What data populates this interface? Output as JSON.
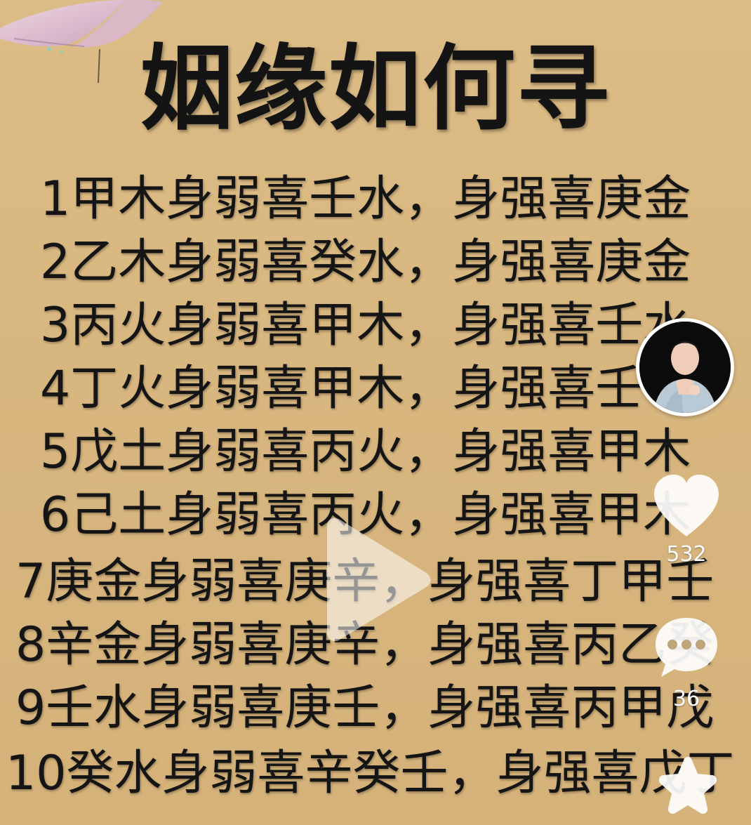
{
  "title": "姻缘如何寻",
  "lines": [
    "1甲木身弱喜壬水，身强喜庚金",
    "2乙木身弱喜癸水，身强喜庚金",
    "3丙火身弱喜甲木，身强喜壬水",
    "4丁火身弱喜甲木，身强喜壬",
    "5戊土身弱喜丙火，身强喜甲木",
    "6己土身弱喜丙火，身强喜甲木",
    "7庚金身弱喜庚辛，身强喜丁甲壬",
    "8辛金身弱喜庚辛，身强喜丙乙癸",
    "9壬水身弱喜庚壬，身强喜丙甲戊",
    "10癸水身弱喜辛癸壬，身强喜戊丁"
  ],
  "actions": {
    "likes": "532",
    "comments": "36"
  },
  "icons": {
    "play": "play-icon",
    "like": "heart-icon",
    "comment": "comment-icon",
    "favorite": "star-icon",
    "decoration": "butterfly-icon"
  },
  "colors": {
    "background": "#d9b881",
    "text": "#151515",
    "overlay": "#ffffff"
  }
}
